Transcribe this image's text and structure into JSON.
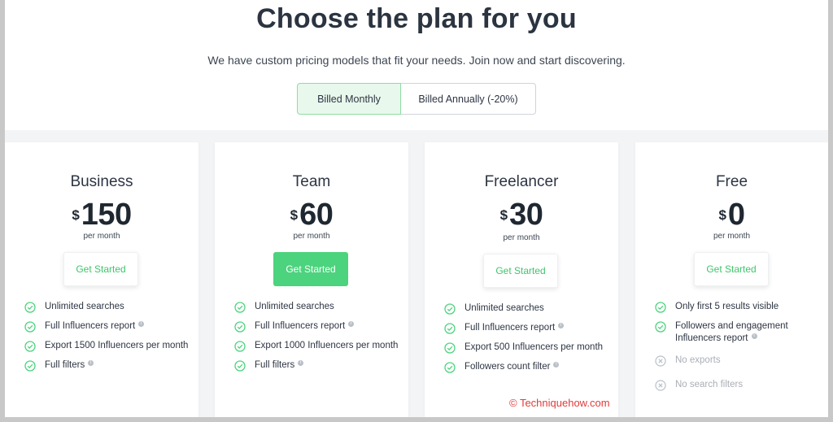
{
  "header": {
    "title": "Choose the plan for you",
    "subtitle": "We have custom pricing models that fit your needs. Join now and start discovering."
  },
  "billing_toggle": {
    "monthly_label": "Billed Monthly",
    "annually_label": "Billed Annually (-20%)",
    "selected": "monthly"
  },
  "plans": [
    {
      "name": "Business",
      "currency": "$",
      "price": "150",
      "period": "per month",
      "cta": "Get Started",
      "features": [
        {
          "text": "Unlimited searches",
          "info": false,
          "enabled": true
        },
        {
          "text": "Full Influencers report",
          "info": true,
          "enabled": true
        },
        {
          "text": "Export 1500 Influencers per month",
          "info": false,
          "enabled": true
        },
        {
          "text": "Full filters",
          "info": true,
          "enabled": true
        }
      ]
    },
    {
      "name": "Team",
      "currency": "$",
      "price": "60",
      "period": "per month",
      "cta": "Get Started",
      "features": [
        {
          "text": "Unlimited searches",
          "info": false,
          "enabled": true
        },
        {
          "text": "Full Influencers report",
          "info": true,
          "enabled": true
        },
        {
          "text": "Export 1000 Influencers per month",
          "info": false,
          "enabled": true
        },
        {
          "text": "Full filters",
          "info": true,
          "enabled": true
        }
      ]
    },
    {
      "name": "Freelancer",
      "currency": "$",
      "price": "30",
      "period": "per month",
      "cta": "Get Started",
      "features": [
        {
          "text": "Unlimited searches",
          "info": false,
          "enabled": true
        },
        {
          "text": "Full Influencers report",
          "info": true,
          "enabled": true
        },
        {
          "text": "Export 500 Influencers per month",
          "info": false,
          "enabled": true
        },
        {
          "text": "Followers count filter",
          "info": true,
          "enabled": true
        }
      ]
    },
    {
      "name": "Free",
      "currency": "$",
      "price": "0",
      "period": "per month",
      "cta": "Get Started",
      "features": [
        {
          "text": "Only first 5 results visible",
          "info": false,
          "enabled": true
        },
        {
          "text": "Followers and engagement Influencers report",
          "info": true,
          "enabled": true
        },
        {
          "text": "No exports",
          "info": false,
          "enabled": false
        },
        {
          "text": "No search filters",
          "info": false,
          "enabled": false
        }
      ]
    }
  ],
  "watermark": "© Techniquehow.com",
  "colors": {
    "accent": "#4cd37d",
    "accent_text": "#3fc56b",
    "heading": "#2b3440",
    "disabled": "#a9afb6",
    "watermark": "#e03a3a"
  }
}
